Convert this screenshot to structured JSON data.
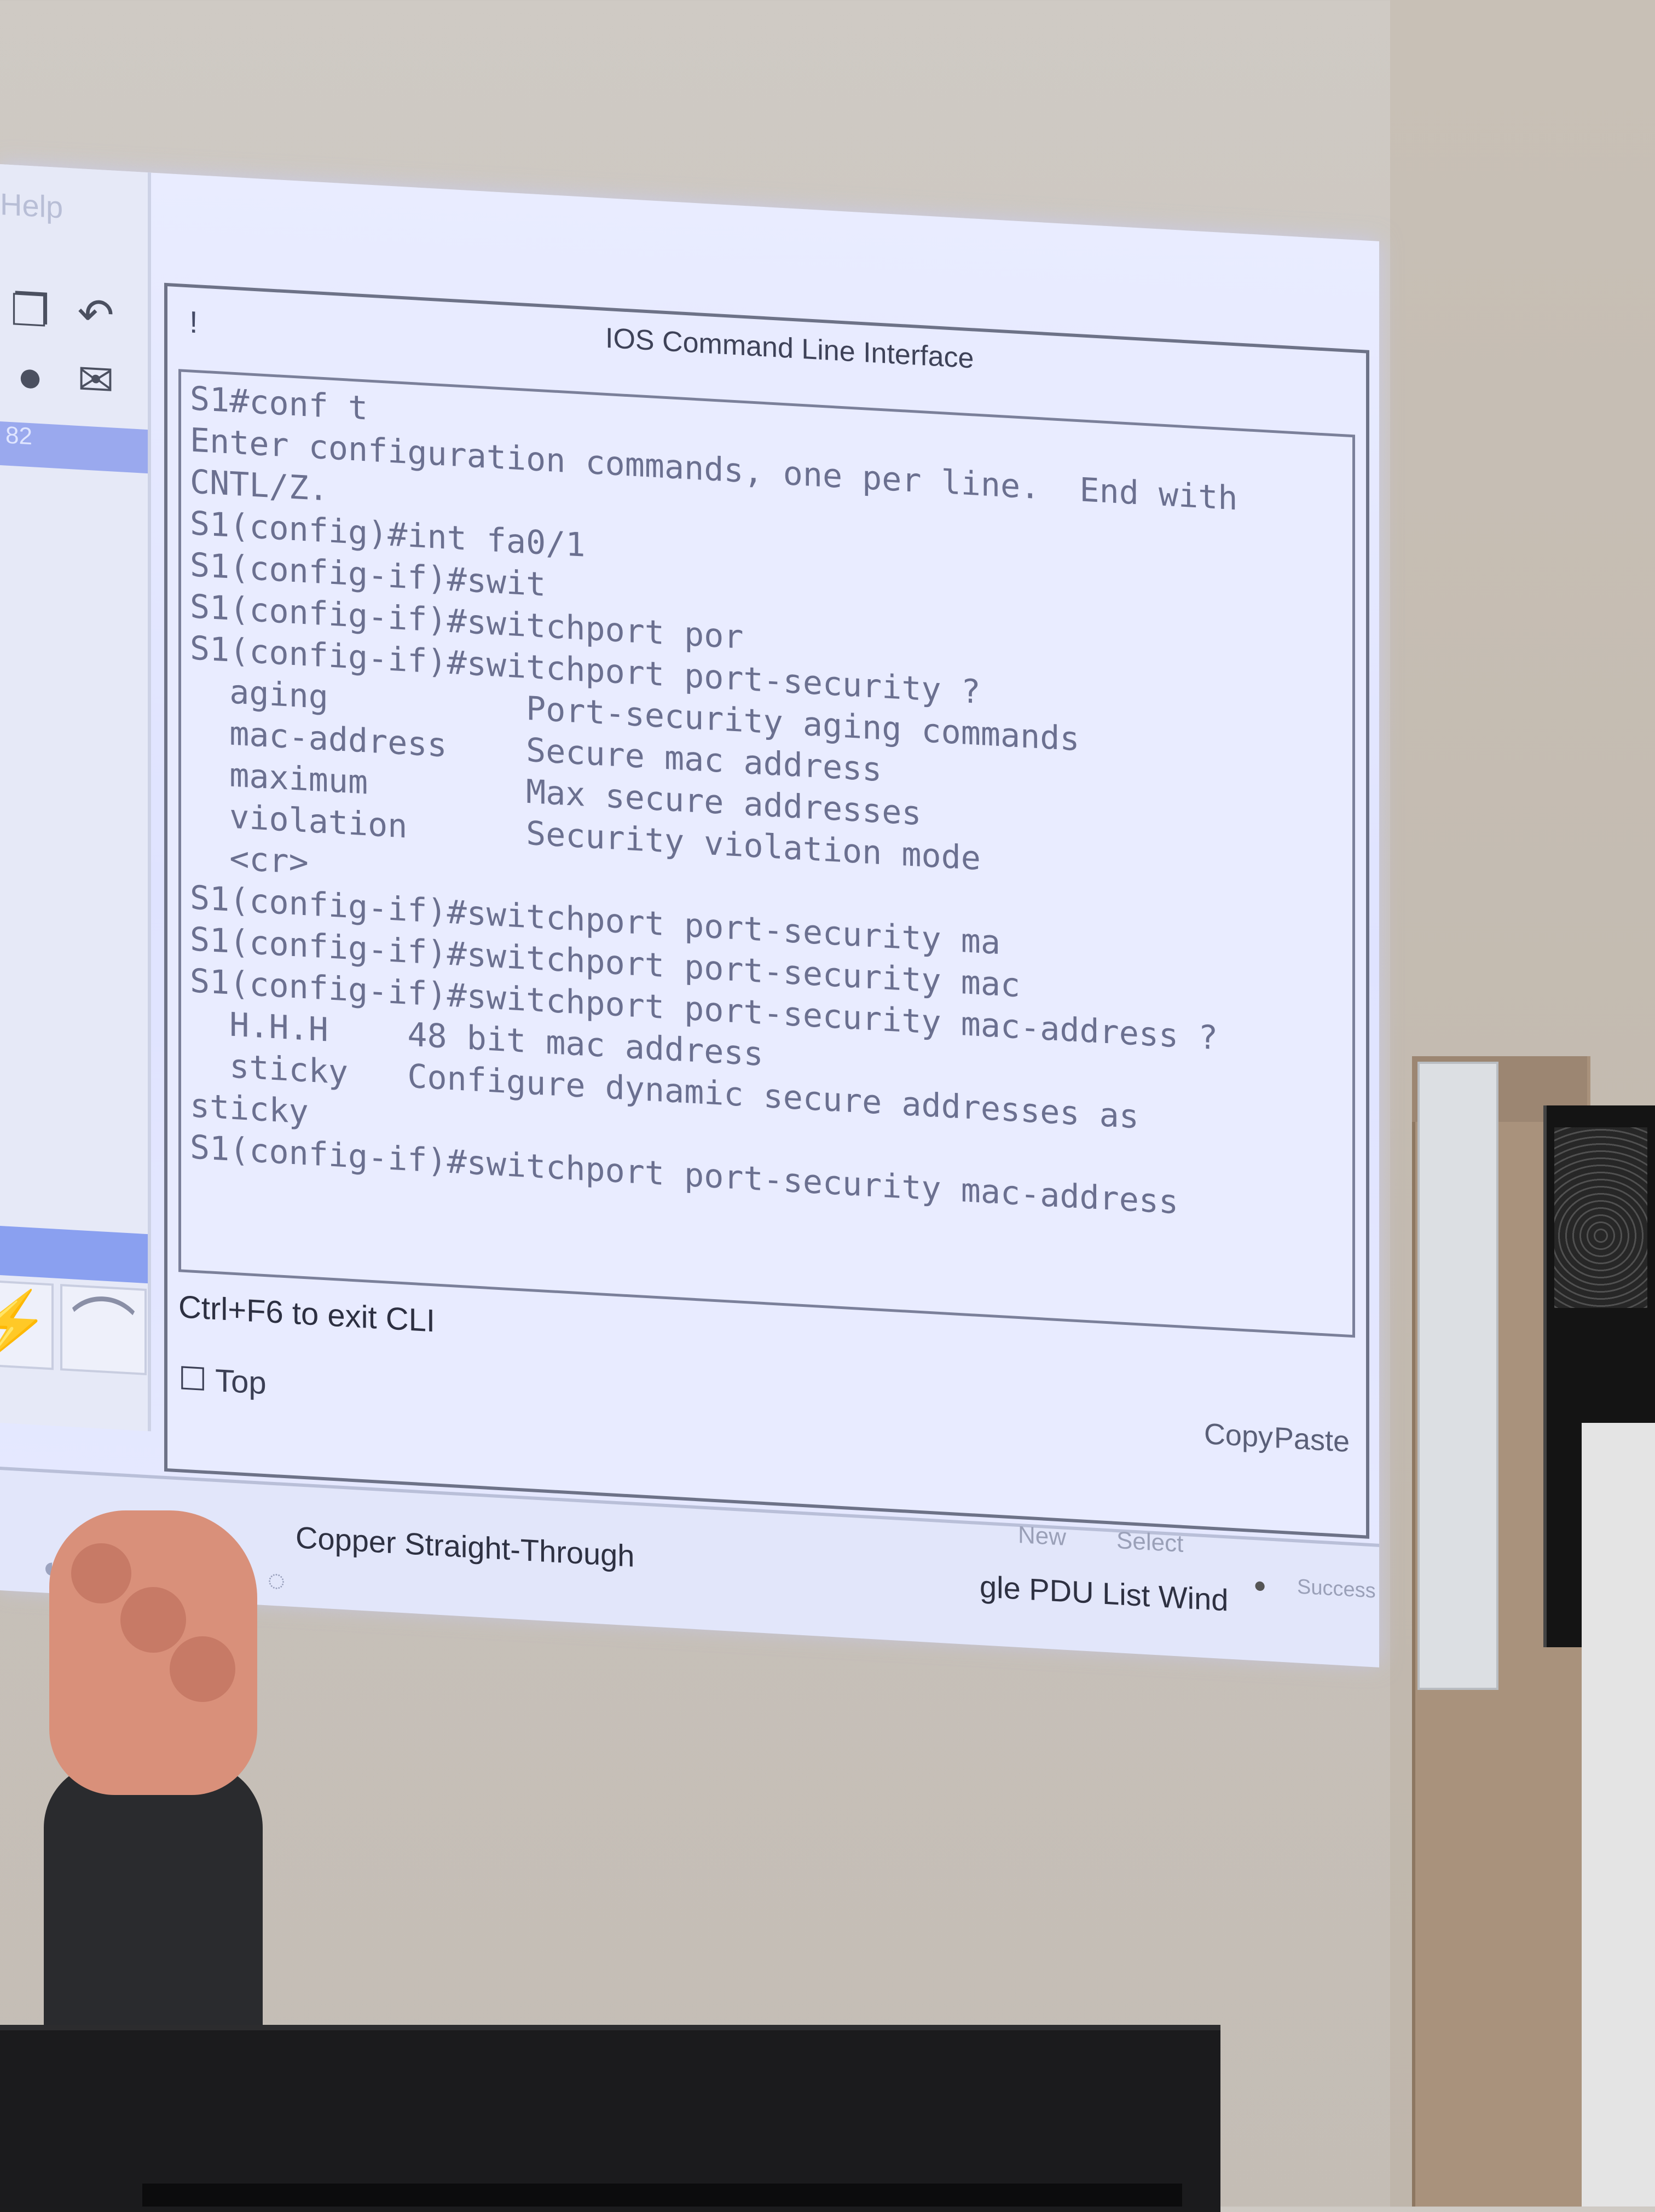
{
  "left_panel": {
    "help_label": "Help",
    "selected_item": "82",
    "icons": [
      "copy-icon",
      "undo-icon",
      "inspect-icon",
      "email-icon"
    ]
  },
  "cli": {
    "title": "IOS Command Line Interface",
    "bang": "!",
    "lines": [
      "S1#conf t",
      "Enter configuration commands, one per line.  End with",
      "CNTL/Z.",
      "S1(config)#int fa0/1",
      "S1(config-if)#swit",
      "S1(config-if)#switchport por",
      "S1(config-if)#switchport port-security ?",
      "  aging          Port-security aging commands",
      "  mac-address    Secure mac address",
      "  maximum        Max secure addresses",
      "  violation      Security violation mode",
      "  <cr>",
      "S1(config-if)#switchport port-security ma",
      "S1(config-if)#switchport port-security mac",
      "S1(config-if)#switchport port-security mac-address ?",
      "  H.H.H    48 bit mac address",
      "  sticky   Configure dynamic secure addresses as",
      "sticky",
      "S1(config-if)#switchport port-security mac-address"
    ],
    "footer_hint": "Ctrl+F6 to exit CLI",
    "top_checkbox_label": "Top",
    "copy_label": "Copy",
    "paste_label": "Paste"
  },
  "bottom_bar": {
    "connection_type": "Copper Straight-Through",
    "pdu_list_label": "gle PDU List Wind",
    "new_label": "New",
    "select_label": "Select",
    "success_label": "Success"
  },
  "colors": {
    "projection_bg": "#e6e9ff",
    "cli_text": "#6b7090",
    "selection_blue": "#8aa0f0"
  }
}
